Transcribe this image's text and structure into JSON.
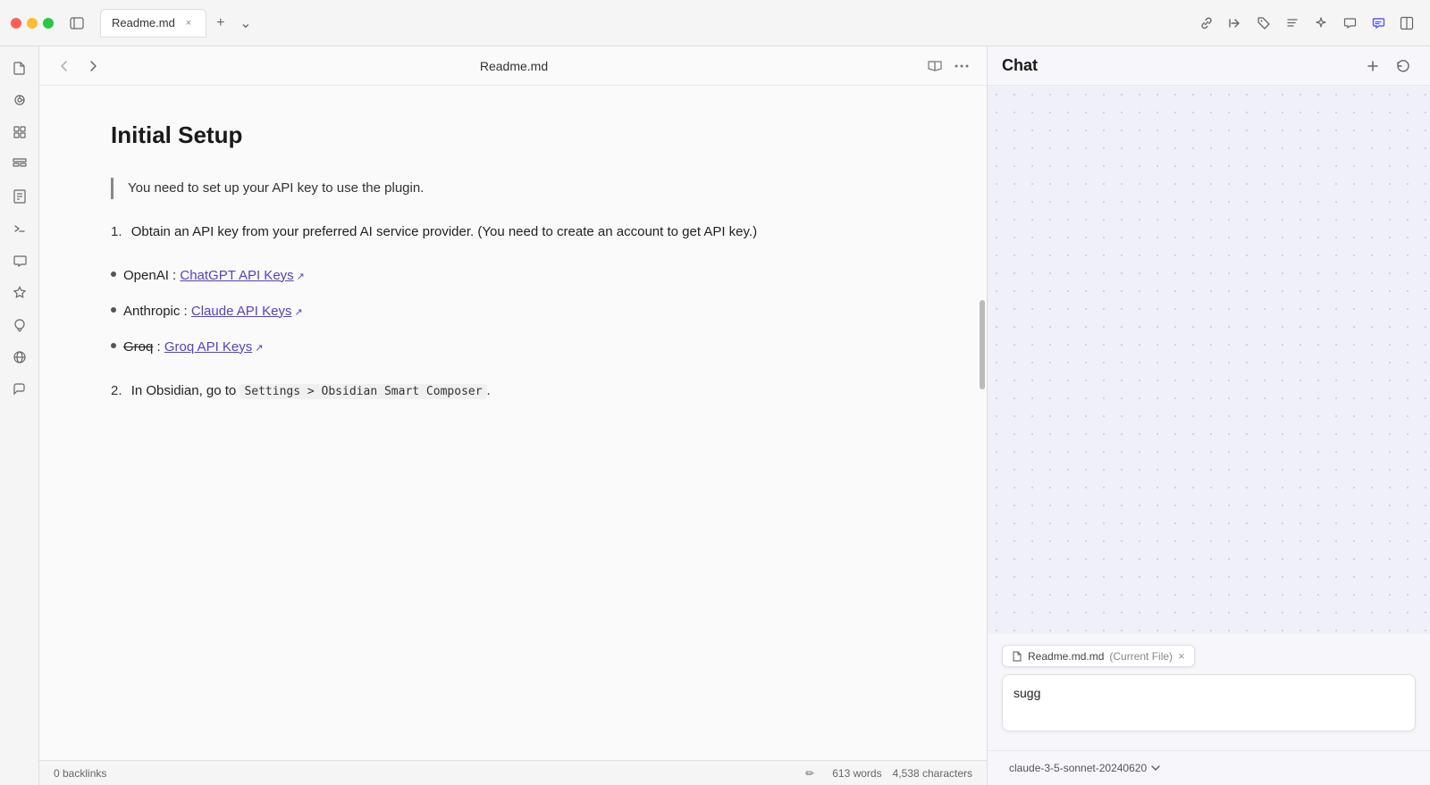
{
  "window": {
    "title": "Readme.md"
  },
  "titlebar": {
    "tab_name": "Readme.md",
    "tab_close": "×",
    "tab_add": "+",
    "tab_dropdown": "⌄"
  },
  "toolbar_icons": [
    {
      "name": "link-icon",
      "symbol": "🔗",
      "active": false
    },
    {
      "name": "anchor-icon",
      "symbol": "⚓",
      "active": false
    },
    {
      "name": "tag-icon",
      "symbol": "🏷",
      "active": false
    },
    {
      "name": "list-icon",
      "symbol": "☰",
      "active": false
    },
    {
      "name": "sparkle-icon",
      "symbol": "✦",
      "active": false
    },
    {
      "name": "comment-icon",
      "symbol": "💬",
      "active": false
    },
    {
      "name": "chat-icon",
      "symbol": "💬",
      "active": true
    },
    {
      "name": "panel-icon",
      "symbol": "⬜",
      "active": false
    }
  ],
  "left_sidebar": {
    "icons": [
      {
        "name": "file-icon",
        "symbol": "📄"
      },
      {
        "name": "graph-icon",
        "symbol": "◎"
      },
      {
        "name": "grid-icon",
        "symbol": "⊞"
      },
      {
        "name": "dashboard-icon",
        "symbol": "📋"
      },
      {
        "name": "book-icon",
        "symbol": "📖"
      },
      {
        "name": "terminal-icon",
        "symbol": ">_"
      },
      {
        "name": "chat-bubble-icon",
        "symbol": "💬"
      },
      {
        "name": "star-icon",
        "symbol": "✦"
      },
      {
        "name": "comment2-icon",
        "symbol": "💬"
      },
      {
        "name": "globe-icon",
        "symbol": "🌐"
      },
      {
        "name": "speech-icon",
        "symbol": "💬"
      }
    ]
  },
  "content_toolbar": {
    "back": "‹",
    "forward": "›",
    "title": "Readme.md",
    "reading_mode": "📖",
    "more": "···"
  },
  "document": {
    "heading": "Initial Setup",
    "blockquote": "You need to set up your API key to use the plugin.",
    "list_items": [
      {
        "main": "Obtain an API key from your preferred AI service provider. (You need to create an account to get API key.)",
        "sub": null
      }
    ],
    "bullet_items": [
      {
        "label": "OpenAI : ",
        "link_text": "ChatGPT API Keys",
        "has_ext": true
      },
      {
        "label": "Anthropic : ",
        "link_text": "Claude API Keys",
        "has_ext": true
      },
      {
        "label": "Groq : ",
        "link_text": "Groq API Keys",
        "has_ext": true,
        "strikethrough_label": true
      }
    ],
    "list_item_2_label": "In Obsidian, go to ",
    "list_item_2_code": "Settings > Obsidian Smart Composer",
    "list_item_2_text": ".",
    "list_item_2_number": "2."
  },
  "status_bar": {
    "backlinks": "0 backlinks",
    "edit_icon": "✏",
    "words": "613 words",
    "chars": "4,538 characters"
  },
  "chat": {
    "title": "Chat",
    "add_btn": "+",
    "history_btn": "↺",
    "file_tag": "Readme.md.md",
    "file_tag_label": "(Current File)",
    "file_tag_close": "×",
    "input_text": "sugg",
    "model_selector": "claude-3-5-sonnet-20240620",
    "model_dropdown": "⌄"
  }
}
